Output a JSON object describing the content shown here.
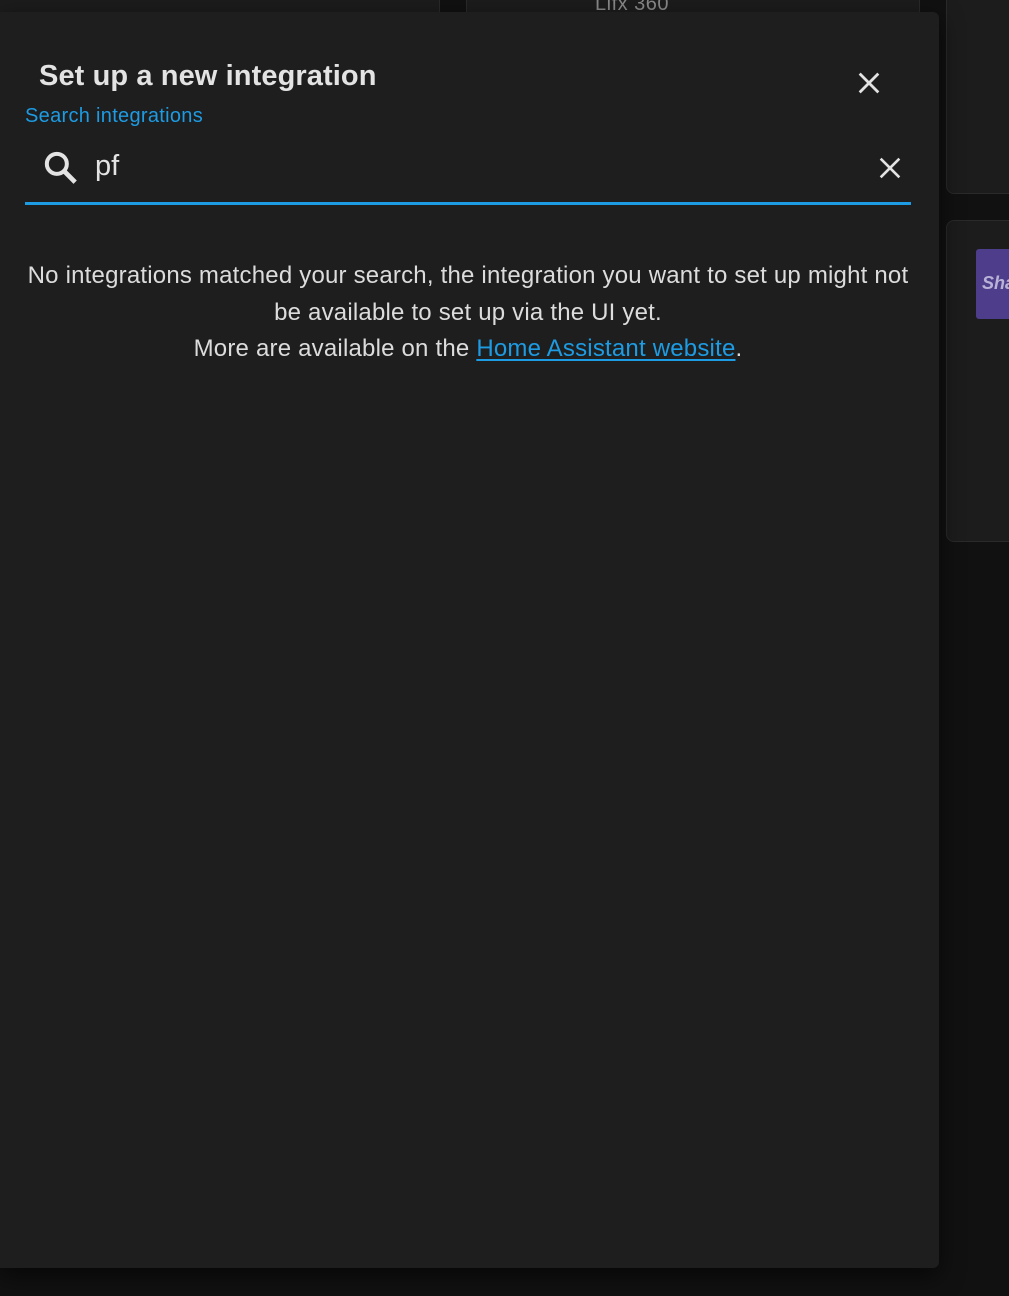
{
  "background": {
    "partial_card_title": "Lifx 360",
    "partial_logo_text": "Sha"
  },
  "dialog": {
    "title": "Set up a new integration",
    "close_icon": "close-icon",
    "search": {
      "label": "Search integrations",
      "value": "pf",
      "search_icon": "magnify-icon",
      "clear_icon": "close-icon"
    },
    "empty_state": {
      "line1": "No integrations matched your search, the integration you want to set up might not be available to set up via the UI yet.",
      "line2_prefix": "More are available on the ",
      "link_text": "Home Assistant website",
      "line2_suffix": "."
    }
  },
  "colors": {
    "accent": "#1d9be3",
    "dialog_background": "#1e1e1e",
    "page_background": "#111111",
    "primary_text": "#e3e3e3"
  }
}
